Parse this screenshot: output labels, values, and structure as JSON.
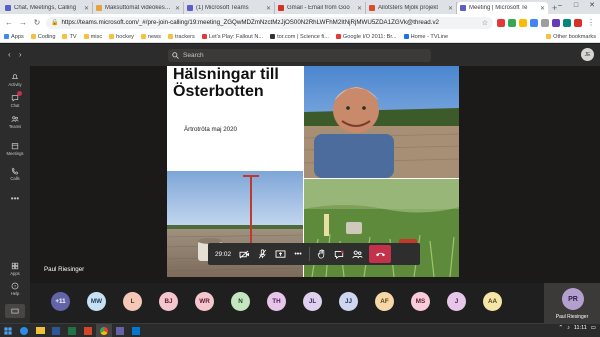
{
  "browser": {
    "tabs": [
      {
        "title": "Chat, Meetings, Calling",
        "color": "#5b5fc7"
      },
      {
        "title": "Maksuttomat videokeskuste",
        "color": "#e6a23c"
      },
      {
        "title": "(1) Microsoft Teams",
        "color": "#5b5fc7"
      },
      {
        "title": "Gmail - Email from Goo",
        "color": "#d93025"
      },
      {
        "title": "Allotsters Mjölk projekt",
        "color": "#e04a2f"
      },
      {
        "title": "Meeting | Microsoft Te",
        "color": "#5b5fc7"
      }
    ],
    "new_tab": "+",
    "url": "https://teams.microsoft.com/_#/pre-join-calling/19:meeting_ZGQwMDZmNzctMzJjOS00N2RhLWFhM2ItNjRjMWU5ZDA1ZGVk@thread.v2",
    "window_controls": [
      "–",
      "□",
      "✕"
    ],
    "bookmarks": [
      {
        "label": "Apps",
        "folder": false,
        "color": "#4285f4"
      },
      {
        "label": "Coding",
        "folder": true
      },
      {
        "label": "TV",
        "folder": true
      },
      {
        "label": "misc",
        "folder": true
      },
      {
        "label": "hockey",
        "folder": true
      },
      {
        "label": "news",
        "folder": true
      },
      {
        "label": "trackers",
        "folder": true
      },
      {
        "label": "Let's Play: Fallout N...",
        "folder": false,
        "color": "#e53935"
      },
      {
        "label": "tor.com | Science fi...",
        "folder": false,
        "color": "#333333"
      },
      {
        "label": "Google I/O 2011: Br...",
        "folder": false,
        "color": "#e53935"
      },
      {
        "label": "Home - TVLine",
        "folder": false,
        "color": "#1a73e8"
      }
    ],
    "other_bookmarks": "Other bookmarks"
  },
  "teams": {
    "search_placeholder": "Search",
    "me_initials": "JE",
    "rail": [
      {
        "label": "Activity",
        "icon": "bell-icon"
      },
      {
        "label": "Chat",
        "icon": "chat-icon"
      },
      {
        "label": "Teams",
        "icon": "teams-icon"
      },
      {
        "label": "Meetings",
        "icon": "calendar-icon"
      },
      {
        "label": "Calls",
        "icon": "phone-icon"
      },
      {
        "label": "",
        "icon": "more-icon"
      },
      {
        "label": "Apps",
        "icon": "apps-icon"
      },
      {
        "label": "Help",
        "icon": "help-icon"
      }
    ]
  },
  "meeting": {
    "slide": {
      "title": "Hälsningar till Österbotten",
      "subtitle": "Ärtrotröta maj 2020"
    },
    "presenter": "Paul Riesinger",
    "timer": "29:02",
    "controls": [
      "camera-icon",
      "mic-icon",
      "share-screen-icon",
      "more-icon",
      "raise-hand-icon",
      "chat-icon",
      "participants-icon",
      "hang-up-icon"
    ],
    "participants": [
      {
        "initials": "+11",
        "color": "#6264a7",
        "text_color": "#ffffff"
      },
      {
        "initials": "MW",
        "color": "#c7e0f4",
        "text_color": "#1f3a56"
      },
      {
        "initials": "L",
        "color": "#f4c7b6",
        "text_color": "#5a2a1a"
      },
      {
        "initials": "BJ",
        "color": "#f4c7cf",
        "text_color": "#5a1a2a"
      },
      {
        "initials": "WR",
        "color": "#f4c7cf",
        "text_color": "#5a1a2a"
      },
      {
        "initials": "N",
        "color": "#c4e5c0",
        "text_color": "#1e4a1a"
      },
      {
        "initials": "TH",
        "color": "#e8c6ea",
        "text_color": "#4a1e4f"
      },
      {
        "initials": "JL",
        "color": "#e0d0f0",
        "text_color": "#3d2a5a"
      },
      {
        "initials": "JJ",
        "color": "#cfd7f0",
        "text_color": "#242f5a"
      },
      {
        "initials": "AF",
        "color": "#f6d8a8",
        "text_color": "#5a3a10"
      },
      {
        "initials": "MS",
        "color": "#f8ccd8",
        "text_color": "#5a1a2a"
      },
      {
        "initials": "J",
        "color": "#e8c6ea",
        "text_color": "#4a1e4f"
      },
      {
        "initials": "AA",
        "color": "#f4e5a8",
        "text_color": "#4f4110"
      }
    ],
    "active_speaker": {
      "initials": "PR",
      "name": "Paul Riesinger"
    }
  },
  "taskbar": {
    "time": "11:11",
    "apps": [
      "start-icon",
      "edge-icon",
      "explorer-icon",
      "word-icon",
      "excel-icon",
      "powerpoint-icon",
      "chrome-icon",
      "teams-icon",
      "outlook-icon"
    ]
  }
}
